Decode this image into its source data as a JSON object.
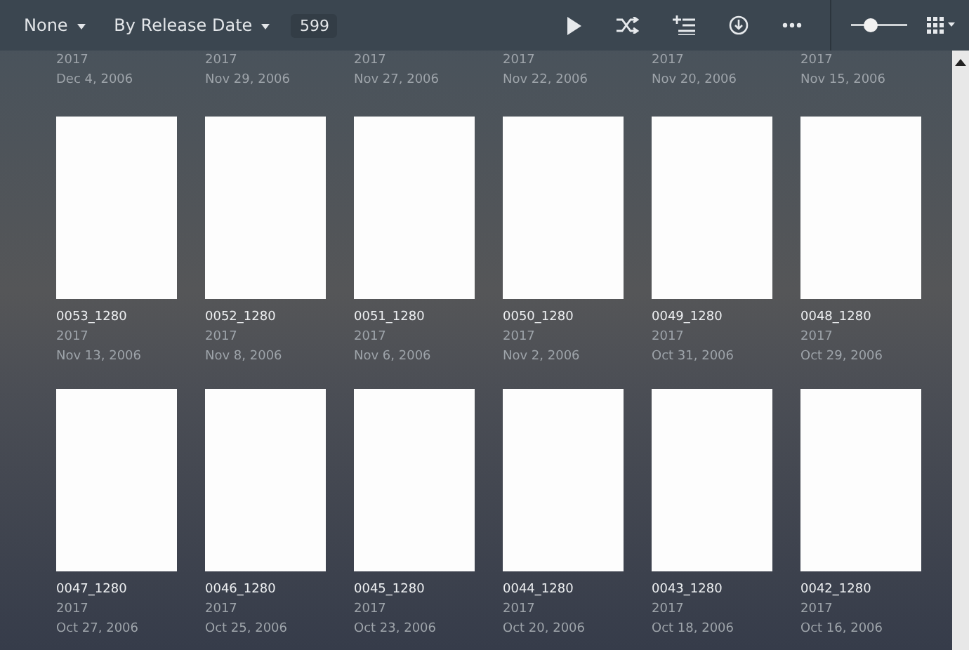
{
  "toolbar": {
    "filter": "None",
    "sort": "By Release Date",
    "count": "599",
    "zoom": {
      "level": 0.35
    }
  },
  "partial_row": [
    {
      "year": "2017",
      "date": "Dec 4, 2006"
    },
    {
      "year": "2017",
      "date": "Nov 29, 2006"
    },
    {
      "year": "2017",
      "date": "Nov 27, 2006"
    },
    {
      "year": "2017",
      "date": "Nov 22, 2006"
    },
    {
      "year": "2017",
      "date": "Nov 20, 2006"
    },
    {
      "year": "2017",
      "date": "Nov 15, 2006"
    }
  ],
  "items": [
    {
      "title": "0053_1280",
      "year": "2017",
      "date": "Nov 13, 2006"
    },
    {
      "title": "0052_1280",
      "year": "2017",
      "date": "Nov 8, 2006"
    },
    {
      "title": "0051_1280",
      "year": "2017",
      "date": "Nov 6, 2006"
    },
    {
      "title": "0050_1280",
      "year": "2017",
      "date": "Nov 2, 2006"
    },
    {
      "title": "0049_1280",
      "year": "2017",
      "date": "Oct 31, 2006"
    },
    {
      "title": "0048_1280",
      "year": "2017",
      "date": "Oct 29, 2006"
    },
    {
      "title": "0047_1280",
      "year": "2017",
      "date": "Oct 27, 2006"
    },
    {
      "title": "0046_1280",
      "year": "2017",
      "date": "Oct 25, 2006"
    },
    {
      "title": "0045_1280",
      "year": "2017",
      "date": "Oct 23, 2006"
    },
    {
      "title": "0044_1280",
      "year": "2017",
      "date": "Oct 20, 2006"
    },
    {
      "title": "0043_1280",
      "year": "2017",
      "date": "Oct 18, 2006"
    },
    {
      "title": "0042_1280",
      "year": "2017",
      "date": "Oct 16, 2006"
    }
  ]
}
